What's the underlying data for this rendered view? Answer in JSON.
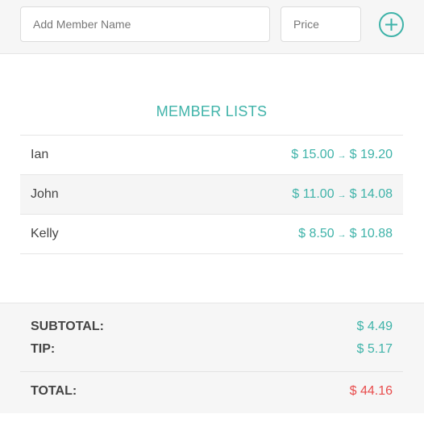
{
  "header": {
    "name_placeholder": "Add Member Name",
    "price_placeholder": "Price",
    "add_icon": "plus-circle-icon"
  },
  "list": {
    "title": "MEMBER LISTS",
    "members": [
      {
        "name": "Ian",
        "price": "$ 15.00",
        "arrow": "→",
        "total": "$ 19.20"
      },
      {
        "name": "John",
        "price": "$ 11.00",
        "arrow": "→",
        "total": "$ 14.08"
      },
      {
        "name": "Kelly",
        "price": "$ 8.50",
        "arrow": "→",
        "total": "$ 10.88"
      }
    ]
  },
  "summary": {
    "subtotal_label": "SUBTOTAL:",
    "subtotal_value": "$ 4.49",
    "tip_label": "TIP:",
    "tip_value": "$ 5.17",
    "total_label": "TOTAL:",
    "total_value": "$ 44.16"
  },
  "colors": {
    "accent": "#3fb3a9",
    "total": "#e84c4c"
  }
}
